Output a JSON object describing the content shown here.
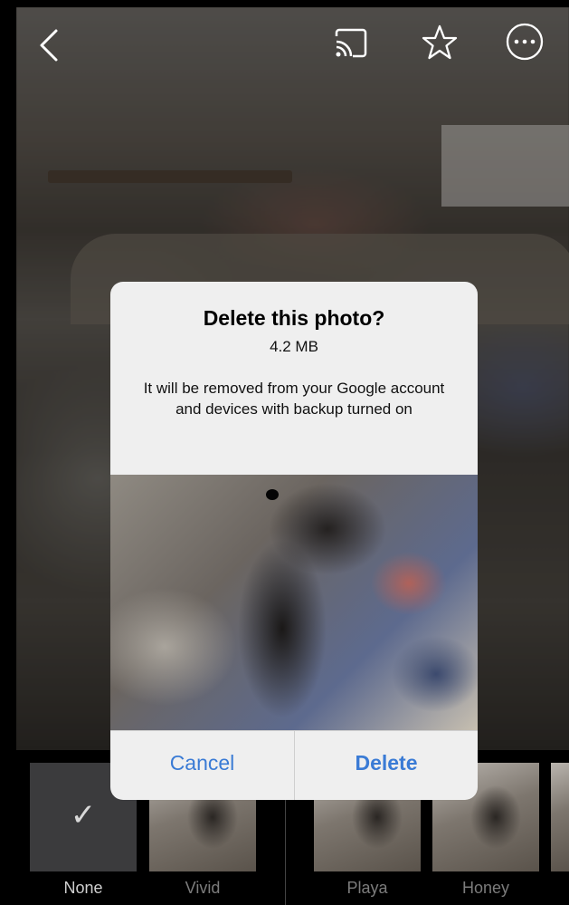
{
  "top_bar": {
    "icons": [
      "chevron-left-icon",
      "cast-icon",
      "star-icon",
      "more-icon"
    ]
  },
  "dialog": {
    "title": "Delete this photo?",
    "size": "4.2 MB",
    "message": "It will be removed from your Google account and devices with backup turned on",
    "cancel_label": "Cancel",
    "delete_label": "Delete",
    "accent_color": "#3a7bd5"
  },
  "filters": {
    "selected_mark": "✓",
    "items": [
      {
        "label": "None",
        "selected": true
      },
      {
        "label": "Vivid",
        "selected": false
      },
      {
        "label": "Playa",
        "selected": false
      },
      {
        "label": "Honey",
        "selected": false
      }
    ]
  }
}
